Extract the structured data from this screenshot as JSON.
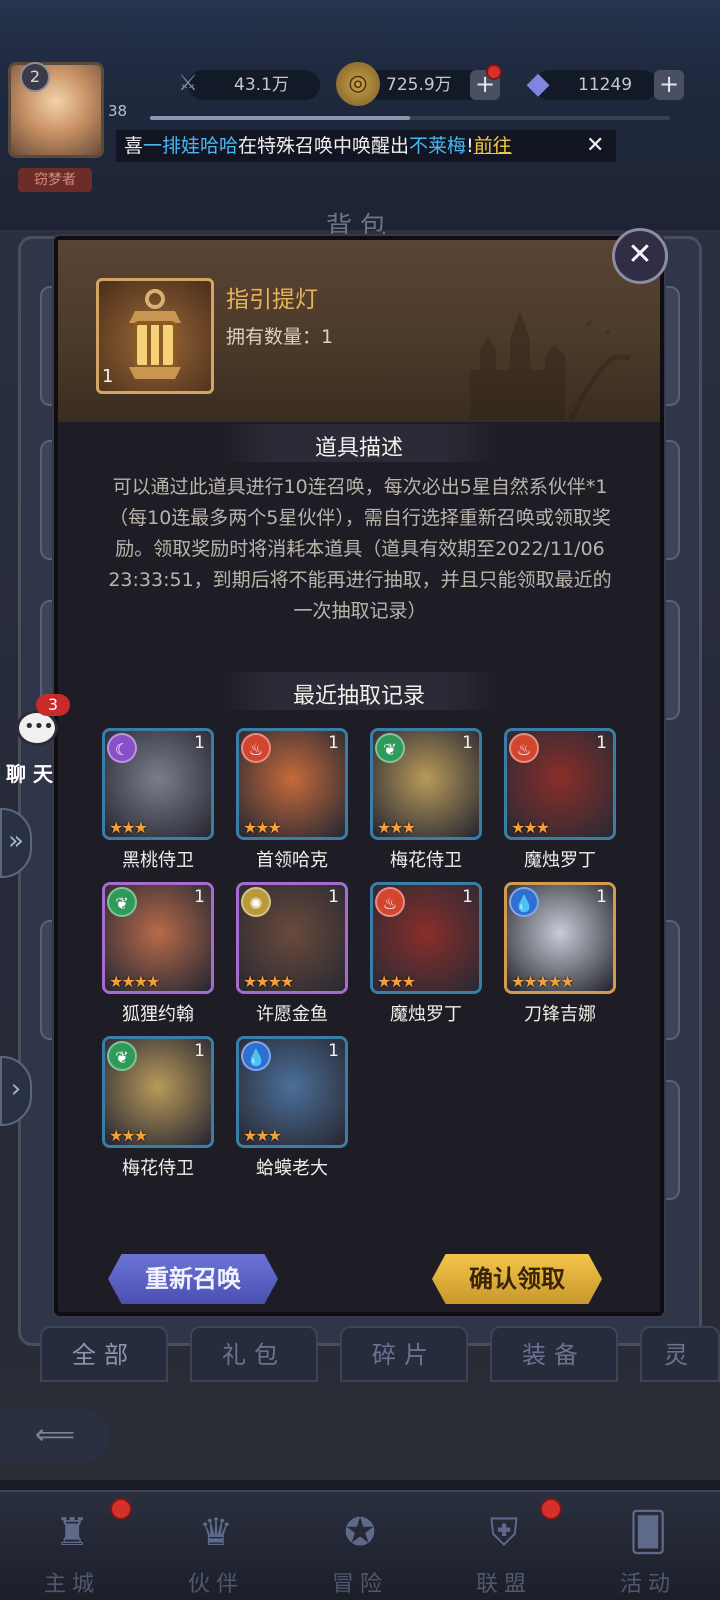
{
  "topbar": {
    "avatar_level": "2",
    "avatar_title": "窃梦者",
    "player_level": "38",
    "power": "43.1万",
    "gold": "725.9万",
    "gems": "11249",
    "plus": "+",
    "marquee": {
      "prefix": "喜",
      "player": "一排娃哈哈",
      "middle": "在特殊召唤中唤醒出",
      "hero": "不莱梅",
      "bang": "!",
      "link": "前往"
    }
  },
  "background": {
    "bag_title": "背包"
  },
  "dialog": {
    "item_name": "指引提灯",
    "item_count": "1",
    "owned_label": "拥有数量：1",
    "desc_title": "道具描述",
    "description": "可以通过此道具进行10连召唤，每次必出5星自然系伙伴*1（每10连最多两个5星伙伴），需自行选择重新召唤或领取奖励。领取奖励时将消耗本道具（道具有效期至2022/11/06 23:33:51，到期后将不能再进行抽取，并且只能领取最近的一次抽取记录）",
    "records_title": "最近抽取记录",
    "heroes": [
      {
        "name": "黑桃侍卫",
        "count": "1",
        "stars": "★★★",
        "element": "moon-icon",
        "color": "#8a4fc8",
        "frame": "blue",
        "art": "#7a7e8c"
      },
      {
        "name": "首领哈克",
        "count": "1",
        "stars": "★★★",
        "element": "fire-icon",
        "color": "#d2452f",
        "frame": "blue",
        "art": "#c76a3a"
      },
      {
        "name": "梅花侍卫",
        "count": "1",
        "stars": "★★★",
        "element": "nature-icon",
        "color": "#2f9a5a",
        "frame": "blue",
        "art": "#b89a5a"
      },
      {
        "name": "魔烛罗丁",
        "count": "1",
        "stars": "★★★",
        "element": "fire-icon",
        "color": "#d2452f",
        "frame": "blue",
        "art": "#8a2e2a"
      },
      {
        "name": "狐狸约翰",
        "count": "1",
        "stars": "★★★★",
        "element": "nature-icon",
        "color": "#2f9a5a",
        "frame": "purple",
        "art": "#b86a4a"
      },
      {
        "name": "许愿金鱼",
        "count": "1",
        "stars": "★★★★",
        "element": "light-icon",
        "color": "#b89a3a",
        "frame": "purple",
        "art": "#6a4a3a"
      },
      {
        "name": "魔烛罗丁",
        "count": "1",
        "stars": "★★★",
        "element": "fire-icon",
        "color": "#d2452f",
        "frame": "blue",
        "art": "#8a2e2a"
      },
      {
        "name": "刀锋吉娜",
        "count": "1",
        "stars": "★★★★★",
        "element": "water-icon",
        "color": "#2f6fd2",
        "frame": "gold",
        "art": "#c8ccd6"
      },
      {
        "name": "梅花侍卫",
        "count": "1",
        "stars": "★★★",
        "element": "nature-icon",
        "color": "#2f9a5a",
        "frame": "blue",
        "art": "#b89a5a"
      },
      {
        "name": "蛤蟆老大",
        "count": "1",
        "stars": "★★★",
        "element": "water-icon",
        "color": "#2f6fd2",
        "frame": "blue",
        "art": "#4a6f9a"
      }
    ],
    "resummon_label": "重新召唤",
    "confirm_label": "确认领取"
  },
  "side": {
    "chat_badge": "3",
    "chat_label": "聊 天"
  },
  "tabs": [
    "全部",
    "礼包",
    "碎片",
    "装备",
    "灵"
  ],
  "nav": [
    {
      "label": "主城",
      "icon": "castle-icon"
    },
    {
      "label": "伙伴",
      "icon": "hat-icon"
    },
    {
      "label": "冒险",
      "icon": "compass-icon"
    },
    {
      "label": "联盟",
      "icon": "shield-icon"
    },
    {
      "label": "活动",
      "icon": "cards-icon"
    }
  ]
}
